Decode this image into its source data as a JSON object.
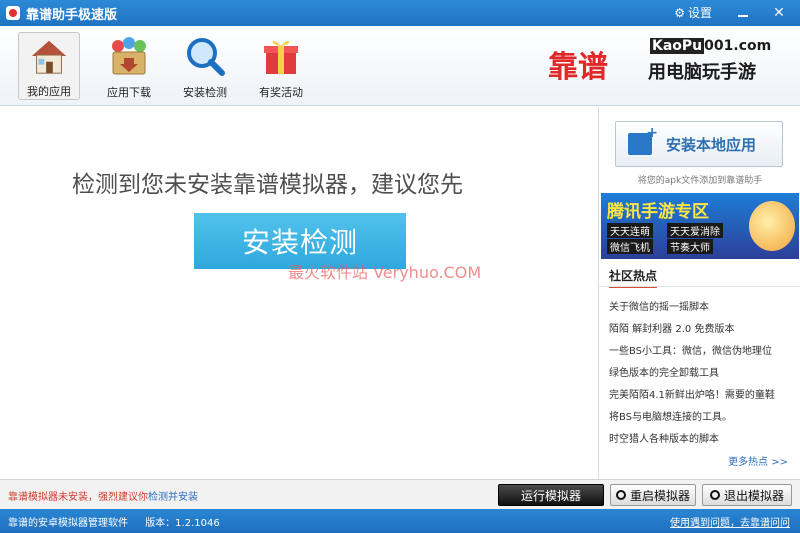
{
  "window": {
    "title": "靠谱助手极速版",
    "settings_label": "设置",
    "settings_icon": "gear-icon",
    "minimize_icon": "minimize-icon",
    "close_icon": "close-icon",
    "accent_color": "#1f73c3"
  },
  "toolbar": {
    "items": [
      {
        "label": "我的应用",
        "icon": "home-icon",
        "active": true
      },
      {
        "label": "应用下载",
        "icon": "app-download-icon",
        "active": false
      },
      {
        "label": "安装检测",
        "icon": "magnifier-icon",
        "active": false
      },
      {
        "label": "有奖活动",
        "icon": "gift-icon",
        "active": false
      }
    ],
    "brand": {
      "name": "靠谱",
      "domain_a": "KaoPu",
      "domain_b": "001.com",
      "tagline": "用电脑玩手游"
    }
  },
  "main": {
    "message": "检测到您未安装靠谱模拟器，建议您先",
    "install_button": "安装检测",
    "watermark": "最火软件站 Veryhuo.COM"
  },
  "sidebar": {
    "install_local_button": "安装本地应用",
    "install_local_hint": "将您的apk文件添加到靠谱助手",
    "banner": {
      "title": "腾讯手游专区",
      "games": [
        "天天连萌",
        "天天爱消除",
        "微信飞机",
        "节奏大师"
      ]
    },
    "hot_title": "社区热点",
    "hot_items": [
      "关于微信的摇一摇脚本",
      "陌陌 解封利器 2.0 免费版本",
      "一些BS小工具：微信，微信伪地理位",
      "绿色版本的完全卸载工具",
      "完美陌陌4.1新鲜出炉咯！需要的童鞋",
      "将BS与电脑想连接的工具。",
      "时空猎人各种版本的脚本"
    ],
    "more_link": "更多热点 >>"
  },
  "status": {
    "warning_text": "靠谱模拟器未安装，强烈建议你",
    "warning_link": "检测并安装",
    "run_button": "运行模拟器",
    "restart_button": "重启模拟器",
    "exit_button": "退出模拟器"
  },
  "footer": {
    "description": "靠谱的安卓模拟器管理软件",
    "version": "版本：1.2.1046",
    "help_link": "使用遇到问题，去靠谱问问"
  }
}
